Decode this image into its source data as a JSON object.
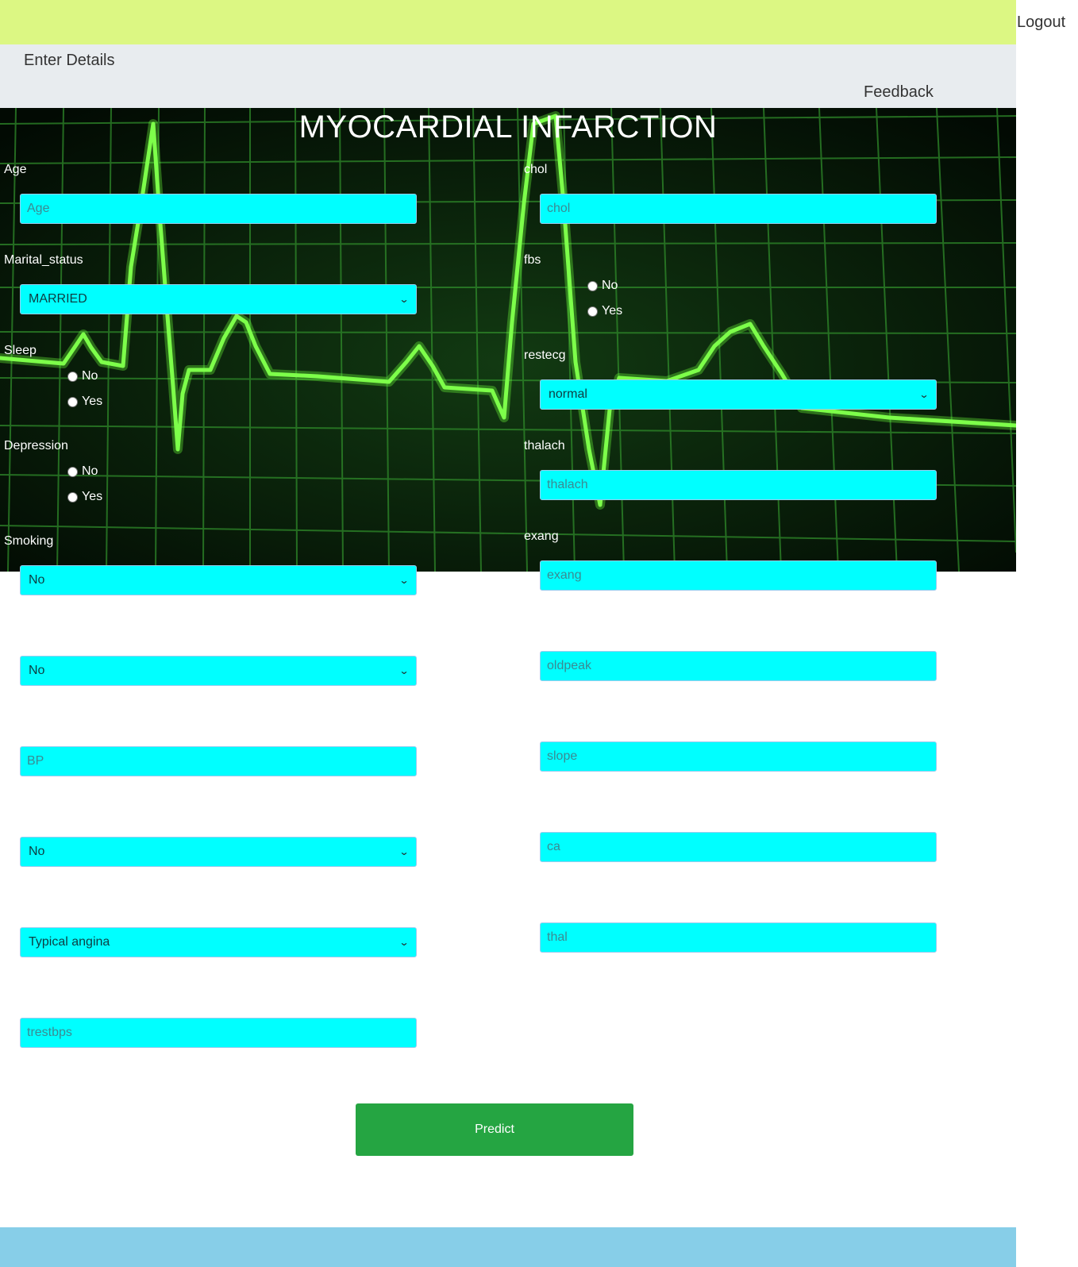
{
  "nav": {
    "logout": "Logout",
    "enter_details": "Enter Details",
    "feedback": "Feedback"
  },
  "title": "MYOCARDIAL INFARCTION",
  "left": {
    "age_label": "Age",
    "age_placeholder": "Age",
    "marital_label": "Marital_status",
    "marital_value": "MARRIED",
    "sleep_label": "Sleep",
    "depression_label": "Depression",
    "smoking_label": "Smoking",
    "smoking_value": "No",
    "select2_value": "No",
    "bp_placeholder": "BP",
    "select3_value": "No",
    "chest_pain_value": "Typical angina",
    "trestbps_placeholder": "trestbps"
  },
  "radio": {
    "no": "No",
    "yes": "Yes"
  },
  "right": {
    "chol_label": "chol",
    "chol_placeholder": "chol",
    "fbs_label": "fbs",
    "restecg_label": "restecg",
    "restecg_value": "normal",
    "thalach_label": "thalach",
    "thalach_placeholder": "thalach",
    "exang_label": "exang",
    "exang_placeholder": "exang",
    "oldpeak_placeholder": "oldpeak",
    "slope_placeholder": "slope",
    "ca_placeholder": "ca",
    "thal_placeholder": "thal"
  },
  "predict_label": "Predict",
  "colors": {
    "topbar": "#dcf783",
    "navbar": "#e8ecef",
    "field_bg": "#00ffff",
    "predict_bg": "#25a542",
    "footer": "#87cee8",
    "ecg_line": "#6cff3a"
  }
}
